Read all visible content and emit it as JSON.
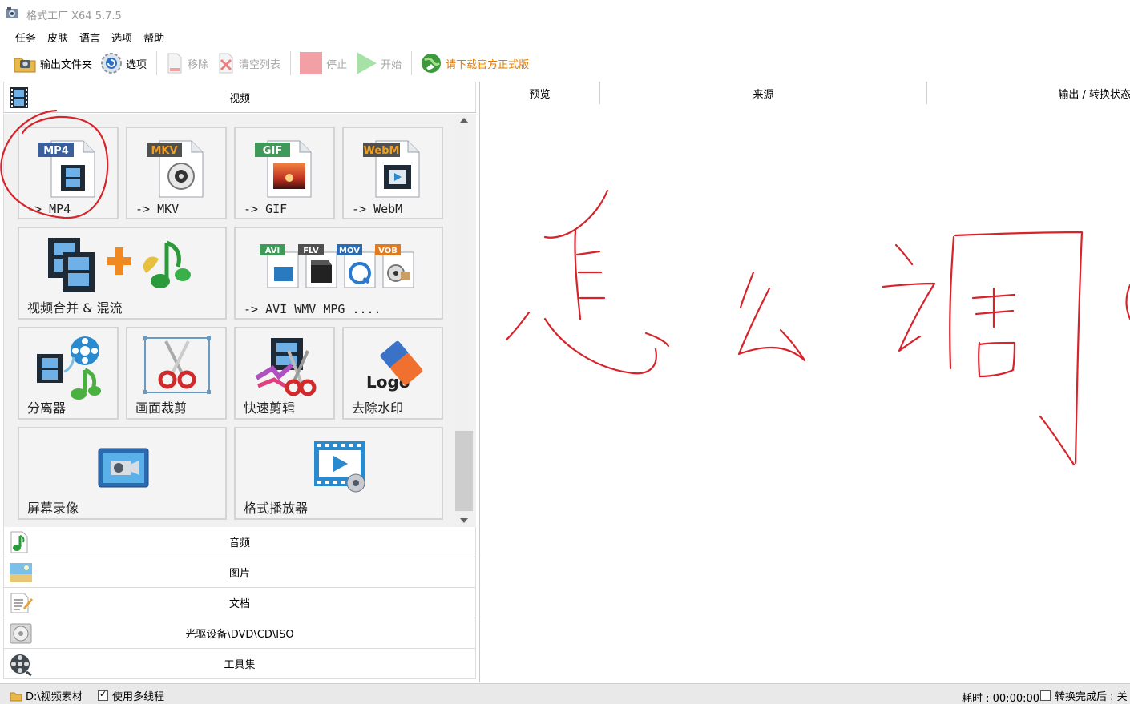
{
  "window": {
    "title": "格式工厂 X64 5.7.5"
  },
  "menu": [
    "任务",
    "皮肤",
    "语言",
    "选项",
    "帮助"
  ],
  "toolbar": {
    "output_folder": "输出文件夹",
    "options": "选项",
    "remove": "移除",
    "clear_list": "清空列表",
    "stop": "停止",
    "start": "开始",
    "download_official": "请下载官方正式版"
  },
  "video_category": "视频",
  "tiles": {
    "mp4": {
      "badge": "MP4",
      "label": "-> MP4"
    },
    "mkv": {
      "badge": "MKV",
      "label": "-> MKV"
    },
    "gif": {
      "badge": "GIF",
      "label": "-> GIF"
    },
    "webm": {
      "badge": "WebM",
      "label": "-> WebM"
    },
    "merge": {
      "label": "视频合并 & 混流"
    },
    "multi": {
      "badges": [
        "AVI",
        "FLV",
        "MOV",
        "VOB"
      ],
      "label": "-> AVI WMV MPG ...."
    },
    "splitter": {
      "label": "分离器"
    },
    "crop": {
      "label": "画面裁剪"
    },
    "quick_edit": {
      "label": "快速剪辑"
    },
    "remove_watermark": {
      "label": "去除水印",
      "logo_text": "Logo"
    },
    "screen_record": {
      "label": "屏幕录像"
    },
    "player": {
      "label": "格式播放器"
    }
  },
  "categories": {
    "audio": "音频",
    "image": "图片",
    "document": "文档",
    "disc": "光驱设备\\DVD\\CD\\ISO",
    "tools": "工具集"
  },
  "columns": {
    "preview": "预览",
    "source": "来源",
    "status": "输出 / 转换状态"
  },
  "statusbar": {
    "folder": "D:\\视频素材",
    "multithread": "使用多线程",
    "multithread_checked": true,
    "elapsed": "耗时 : 00:00:00",
    "after_convert": "转换完成后 : 关"
  },
  "colors": {
    "annotation_red": "#d8232a",
    "promo_orange": "#e07a00"
  }
}
